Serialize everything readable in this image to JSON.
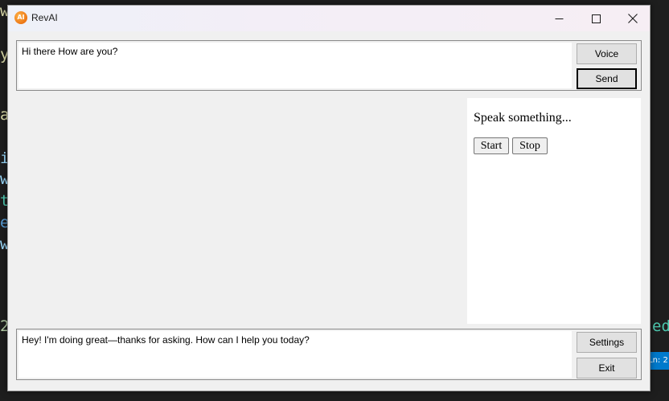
{
  "app": {
    "title": "RevAI",
    "icon_label": "AI"
  },
  "window_controls": {
    "minimize_icon": "minimize-icon",
    "maximize_icon": "maximize-icon",
    "close_icon": "close-icon"
  },
  "background_editor": {
    "fragments": [
      "w",
      "y",
      "a",
      "i",
      "w",
      "t",
      "e",
      "w",
      "2",
      "edB"
    ],
    "status_text": "Ln: 2"
  },
  "input": {
    "value": "Hi there How are you?",
    "voice_label": "Voice",
    "send_label": "Send"
  },
  "speech": {
    "prompt": "Speak something...",
    "start_label": "Start",
    "stop_label": "Stop"
  },
  "response": {
    "text": "Hey! I'm doing great—thanks for asking. How can I help you today?",
    "settings_label": "Settings",
    "exit_label": "Exit"
  }
}
